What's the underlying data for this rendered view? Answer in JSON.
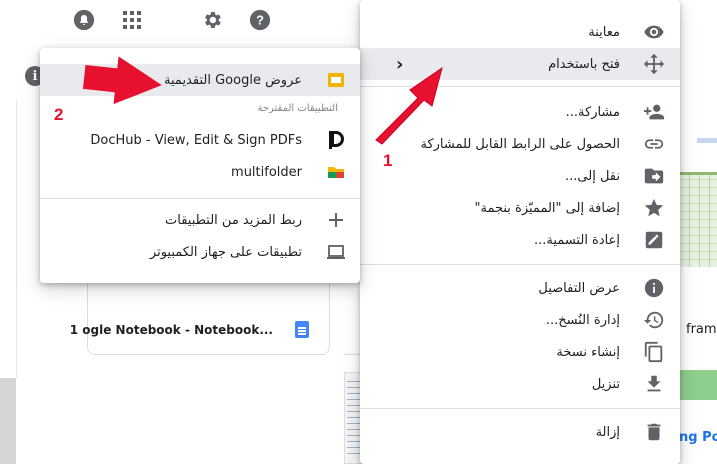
{
  "colors": {
    "accent_red": "#e8102f",
    "icon_gray": "#5f6368",
    "highlight": "#e8eaed",
    "slides_yellow": "#f4b400",
    "docs_blue": "#4285f4"
  },
  "background": {
    "file_card_title": "1 ogle Notebook - Notebook...",
    "partial_text_right": "framw",
    "partial_text_bottom": "ng Po",
    "topbar_icons": [
      "notifications-icon",
      "apps-grid-icon",
      "settings-gear-icon",
      "help-icon"
    ]
  },
  "context_menu": {
    "items": [
      {
        "label": "معاينة",
        "icon": "eye-icon"
      },
      {
        "label": "فتح باستخدام",
        "icon": "move-arrows-icon",
        "highlighted": true,
        "submenu_chevron": "‹"
      },
      {
        "label": "مشاركة...",
        "icon": "person-add-icon"
      },
      {
        "label": "الحصول على الرابط القابل للمشاركة",
        "icon": "link-icon"
      },
      {
        "label": "نقل إلى...",
        "icon": "folder-move-icon"
      },
      {
        "label": "إضافة إلى \"المميّزة بنجمة\"",
        "icon": "star-icon"
      },
      {
        "label": "إعادة التسمية...",
        "icon": "edit-pencil-icon"
      },
      {
        "label": "عرض التفاصيل",
        "icon": "info-icon"
      },
      {
        "label": "إدارة النُسخ...",
        "icon": "history-icon"
      },
      {
        "label": "إنشاء نسخة",
        "icon": "copy-icon"
      },
      {
        "label": "تنزيل",
        "icon": "download-icon"
      },
      {
        "label": "إزالة",
        "icon": "trash-icon"
      }
    ]
  },
  "open_with_menu": {
    "primary": {
      "label": "عروض Google التقديمية",
      "icon": "google-slides-icon"
    },
    "suggested_heading": "التطبيقات المقترحة",
    "suggested": [
      {
        "label": "DocHub - View, Edit & Sign PDFs",
        "icon": "dochub-icon"
      },
      {
        "label": "multifolder",
        "icon": "multifolder-icon"
      }
    ],
    "more": [
      {
        "label": "ربط المزيد من التطبيقات",
        "icon": "plus-icon"
      },
      {
        "label": "تطبيقات على جهاز الكمبيوتر",
        "icon": "laptop-icon"
      }
    ]
  },
  "annotations": {
    "step1": "1",
    "step2": "2"
  }
}
